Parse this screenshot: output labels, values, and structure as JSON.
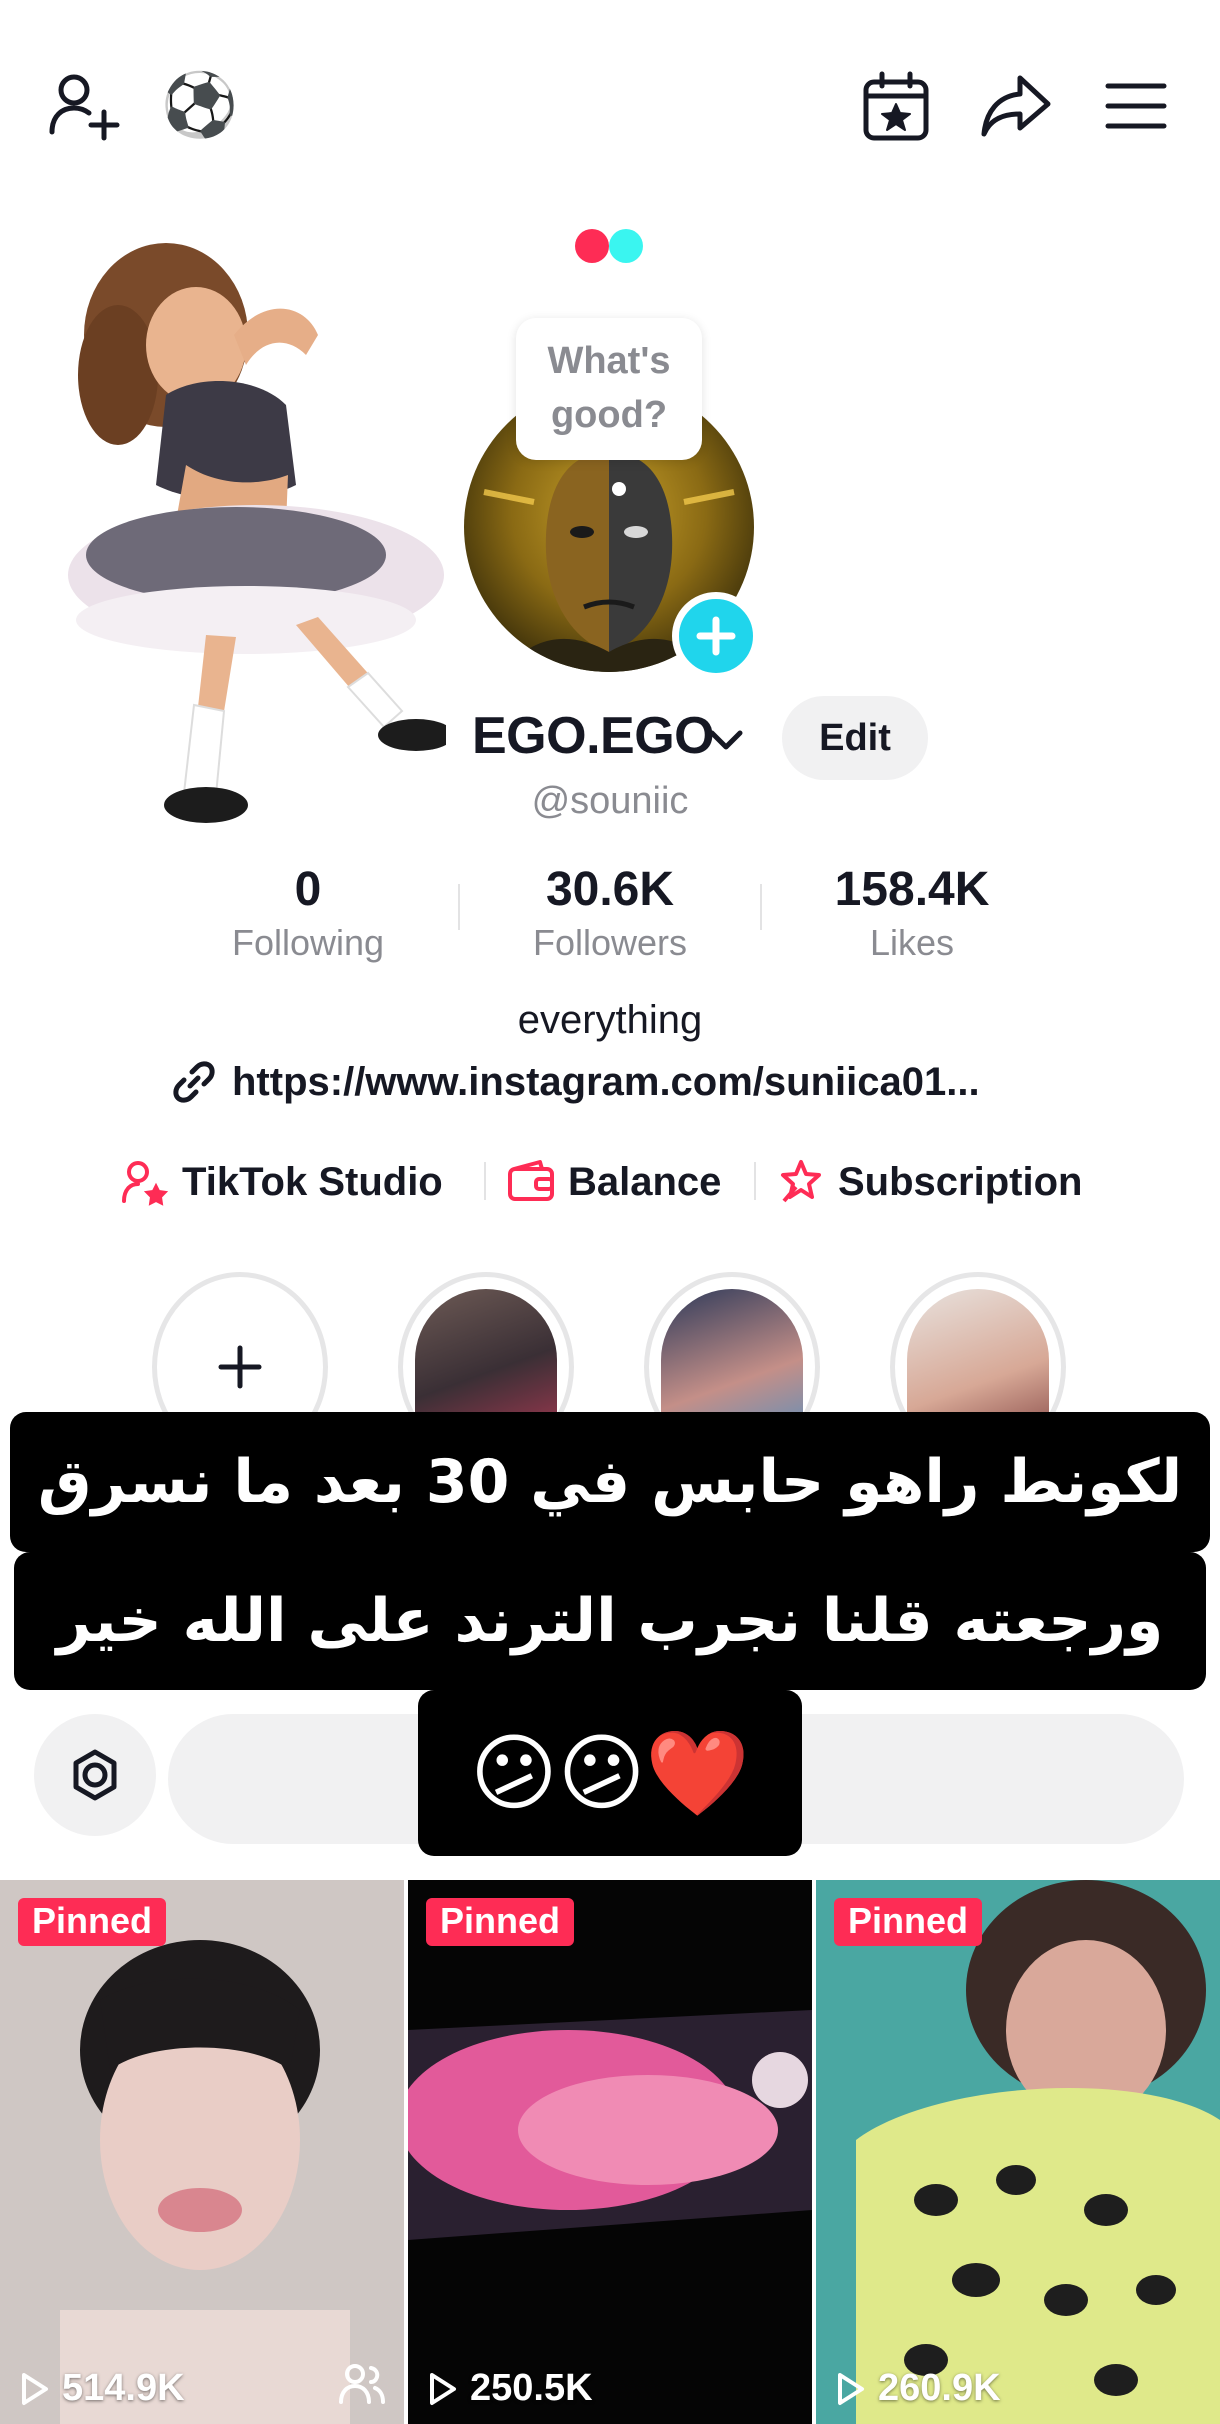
{
  "header": {
    "add_friend_icon": "person-add-icon",
    "emoji": "⚽",
    "icons": [
      "calendar-star-icon",
      "share-arrow-icon",
      "menu-icon"
    ]
  },
  "profile": {
    "status_bubble_line1": "What's",
    "status_bubble_line2": "good?",
    "display_name": "EGO.EGO",
    "edit_label": "Edit",
    "handle": "@souniic",
    "bio": "everything",
    "link": "https://www.instagram.com/suniica01..."
  },
  "stats": [
    {
      "value": "0",
      "label": "Following"
    },
    {
      "value": "30.6K",
      "label": "Followers"
    },
    {
      "value": "158.4K",
      "label": "Likes"
    }
  ],
  "tools": {
    "studio": "TikTok Studio",
    "balance": "Balance",
    "subscription": "Subscription"
  },
  "caption": {
    "line1": "لكونط راهو حابس في 30 بعد ما نسرق",
    "line2": "ورجعته  قلنا نجرب الترند على الله خير",
    "line3": "❤️😕😕"
  },
  "videos": [
    {
      "badge": "Pinned",
      "views": "514.9K"
    },
    {
      "badge": "Pinned",
      "views": "250.5K"
    },
    {
      "badge": "Pinned",
      "views": "260.9K"
    }
  ],
  "colors": {
    "accent": "#fe2c55",
    "cyan": "#20d5ec",
    "muted": "#8a8b91",
    "chip_bg": "#f1f1f2"
  }
}
